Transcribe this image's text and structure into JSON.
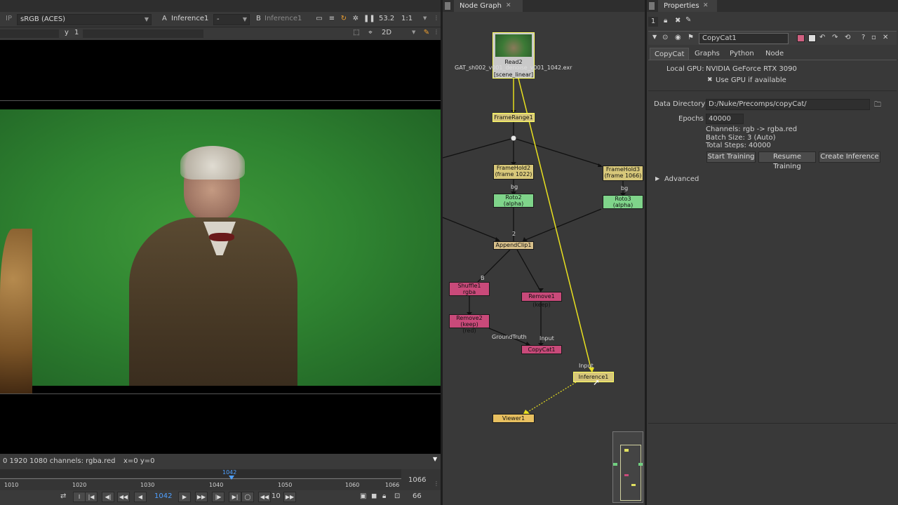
{
  "viewer": {
    "ip_label": "IP",
    "colorspace": "sRGB (ACES)",
    "input_a_prefix": "A",
    "input_a": "Inference1",
    "input_a_op": "-",
    "input_b_prefix": "B",
    "input_b": "Inference1",
    "zoom_pct": "53.2",
    "ratio": "1:1",
    "y_label": "y",
    "y_value": "1",
    "view_mode": "2D",
    "info_text": "0 1920 1080 channels: rgba.red",
    "coords_text": "x=0 y=0",
    "timeline": {
      "ticks": [
        "1010",
        "1020",
        "1030",
        "1040",
        "1050",
        "1060",
        "1066"
      ],
      "current_marker": "1042",
      "end_frame": "1066"
    },
    "transport": {
      "current_frame": "1042",
      "step": "10",
      "fps": "66"
    }
  },
  "node_graph": {
    "tab_label": "Node Graph",
    "nodes": {
      "read": "Read2",
      "read_file": "GAT_sh002_v001_denoise_v001_1042.exr",
      "read_cs": "[scene_linear]",
      "framerange": "FrameRange1",
      "framehold2": "FrameHold2",
      "framehold2_sub": "(frame 1022)",
      "framehold3": "FrameHold3",
      "framehold3_sub": "(frame 1066)",
      "bg_left": "bg",
      "bg_right": "bg",
      "roto2": "Roto2",
      "roto2_sub": "(alpha)",
      "roto3": "Roto3",
      "roto3_sub": "(alpha)",
      "input_num": "2",
      "appendclip": "AppendClip1",
      "shuffle_num": "B",
      "shuffle": "Shuffle1",
      "shuffle_sub": "rgba",
      "remove1": "Remove1 (keep)",
      "remove2": "Remove2 (keep)",
      "remove2_sub": "(red)",
      "groundtruth": "GroundTruth",
      "input_label1": "Input",
      "copycat": "CopyCat1",
      "input_label2": "Input",
      "inference": "Inference1",
      "viewer": "Viewer1"
    }
  },
  "properties": {
    "tab_label": "Properties",
    "node_count": "1",
    "node_name": "CopyCat1",
    "tabs": [
      "CopyCat",
      "Graphs",
      "Python",
      "Node"
    ],
    "local_gpu_label": "Local GPU:",
    "local_gpu_value": "NVIDIA GeForce RTX 3090",
    "use_gpu_label": "Use GPU if available",
    "data_dir_label": "Data Directory",
    "data_dir_value": "D:/Nuke/Precomps/copyCat/",
    "epochs_label": "Epochs",
    "epochs_value": "40000",
    "channels_text": "Channels: rgb -> rgba.red",
    "batch_text": "Batch Size: 3 (Auto)",
    "steps_text": "Total Steps: 40000",
    "btn_start": "Start Training",
    "btn_resume": "Resume Training",
    "btn_create": "Create Inference",
    "advanced_label": "Advanced"
  }
}
